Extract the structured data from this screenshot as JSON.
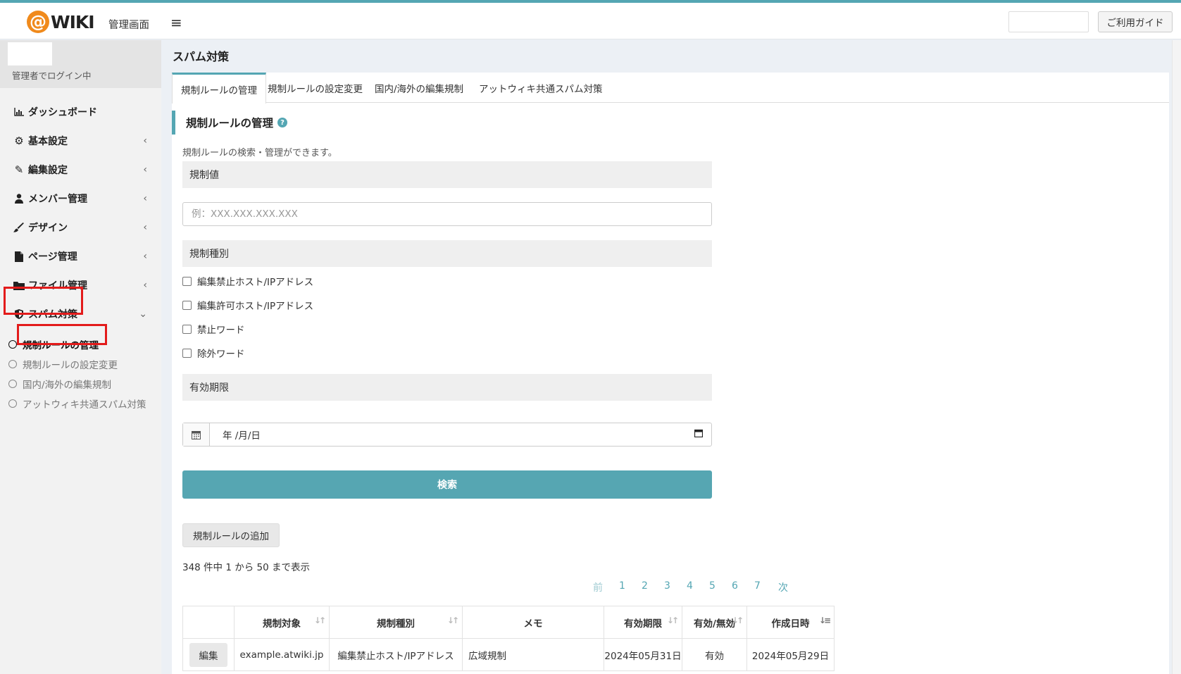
{
  "header": {
    "logo_at": "@",
    "logo_text": "WIKI",
    "title": "管理画面",
    "guide_button": "ご利用ガイド"
  },
  "sidebar": {
    "user_status": "管理者でログイン中",
    "menu": [
      {
        "label": "ダッシュボード",
        "icon": "bar-chart-icon"
      },
      {
        "label": "基本設定",
        "icon": "gear-icon"
      },
      {
        "label": "編集設定",
        "icon": "pencil-icon"
      },
      {
        "label": "メンバー管理",
        "icon": "user-icon"
      },
      {
        "label": "デザイン",
        "icon": "paintbrush-icon"
      },
      {
        "label": "ページ管理",
        "icon": "file-icon"
      },
      {
        "label": "ファイル管理",
        "icon": "folder-icon"
      },
      {
        "label": "スパム対策",
        "icon": "shield-icon"
      }
    ],
    "submenu": [
      {
        "label": "規制ルールの管理",
        "active": true
      },
      {
        "label": "規制ルールの設定変更"
      },
      {
        "label": "国内/海外の編集規制"
      },
      {
        "label": "アットウィキ共通スパム対策"
      }
    ]
  },
  "page": {
    "title": "スパム対策",
    "tabs": [
      "規制ルールの管理",
      "規制ルールの設定変更",
      "国内/海外の編集規制",
      "アットウィキ共通スパム対策"
    ],
    "section_title": "規制ルールの管理",
    "description": "規制ルールの検索・管理ができます。",
    "form": {
      "value_label": "規制値",
      "value_placeholder": "例：XXX.XXX.XXX.XXX",
      "type_label": "規制種別",
      "type_options": [
        "編集禁止ホスト/IPアドレス",
        "編集許可ホスト/IPアドレス",
        "禁止ワード",
        "除外ワード"
      ],
      "expiry_label": "有効期限",
      "date_placeholder": "年 /月/日",
      "search_button": "検索"
    },
    "add_button": "規制ルールの追加",
    "count_text": "348 件中 1 から 50 まで表示",
    "pagination": {
      "prev": "前",
      "pages": [
        "1",
        "2",
        "3",
        "4",
        "5",
        "6",
        "7"
      ],
      "next": "次"
    },
    "table": {
      "headers": [
        "",
        "規制対象",
        "規制種別",
        "メモ",
        "有効期限",
        "有効/無効",
        "作成日時"
      ],
      "rows": [
        {
          "edit": "編集",
          "target": "example.atwiki.jp",
          "type": "編集禁止ホスト/IPアドレス",
          "memo": "広域規制",
          "expiry": "2024年05月31日",
          "status": "有効",
          "created": "2024年05月29日"
        }
      ]
    }
  },
  "colors": {
    "accent": "#54a6b3",
    "highlight": "#e31b1b",
    "logo_orange": "#f08a1c"
  }
}
